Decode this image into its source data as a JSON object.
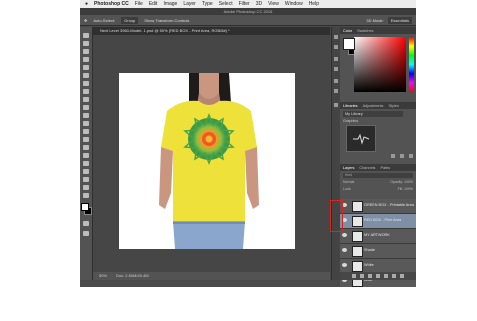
{
  "menubar": {
    "apple": "",
    "app_name": "Photoshop CC",
    "items": [
      "File",
      "Edit",
      "Image",
      "Layer",
      "Type",
      "Select",
      "Filter",
      "3D",
      "View",
      "Window",
      "Help"
    ]
  },
  "window_title": "Adobe Photoshop CC 2015",
  "options": {
    "auto_select": "Auto-Select:",
    "auto_select_value": "Group",
    "transform": "Show Transform Controls",
    "mode_3d": "3D Mode:",
    "workspace": "Essentials"
  },
  "document_tab": "Next Level 3960-Model- 1.psd @ 50% (RED BOX - Print Area, RGB/8#) *",
  "status": {
    "zoom": "50%",
    "doc": "Doc: 2.60M/40.4M"
  },
  "color_panel": {
    "tabs": [
      "Color",
      "Swatches"
    ]
  },
  "libraries_panel": {
    "tabs": [
      "Libraries",
      "Adjustments",
      "Styles"
    ],
    "library": "My Library",
    "section": "Graphics"
  },
  "layers_panel": {
    "tabs": [
      "Layers",
      "Channels",
      "Paths"
    ],
    "kind": "Kind",
    "blend": "Normal",
    "opacity": "Opacity: 100%",
    "lock": "Lock:",
    "fill": "Fill: 100%",
    "layers": [
      {
        "name": "GREEN BOX - Printable Area",
        "selected": false
      },
      {
        "name": "RED BOX - Print Area",
        "selected": true
      },
      {
        "name": "MY ARTWORK",
        "selected": false
      },
      {
        "name": "Shade",
        "selected": false
      },
      {
        "name": "White",
        "selected": false
      },
      {
        "name": "Base",
        "selected": false
      },
      {
        "name": "Bk Plate",
        "selected": false
      }
    ]
  },
  "colors": {
    "shirt": "#ede13a",
    "highlight": "#d7261e",
    "selected_layer": "#7e8fa6"
  }
}
